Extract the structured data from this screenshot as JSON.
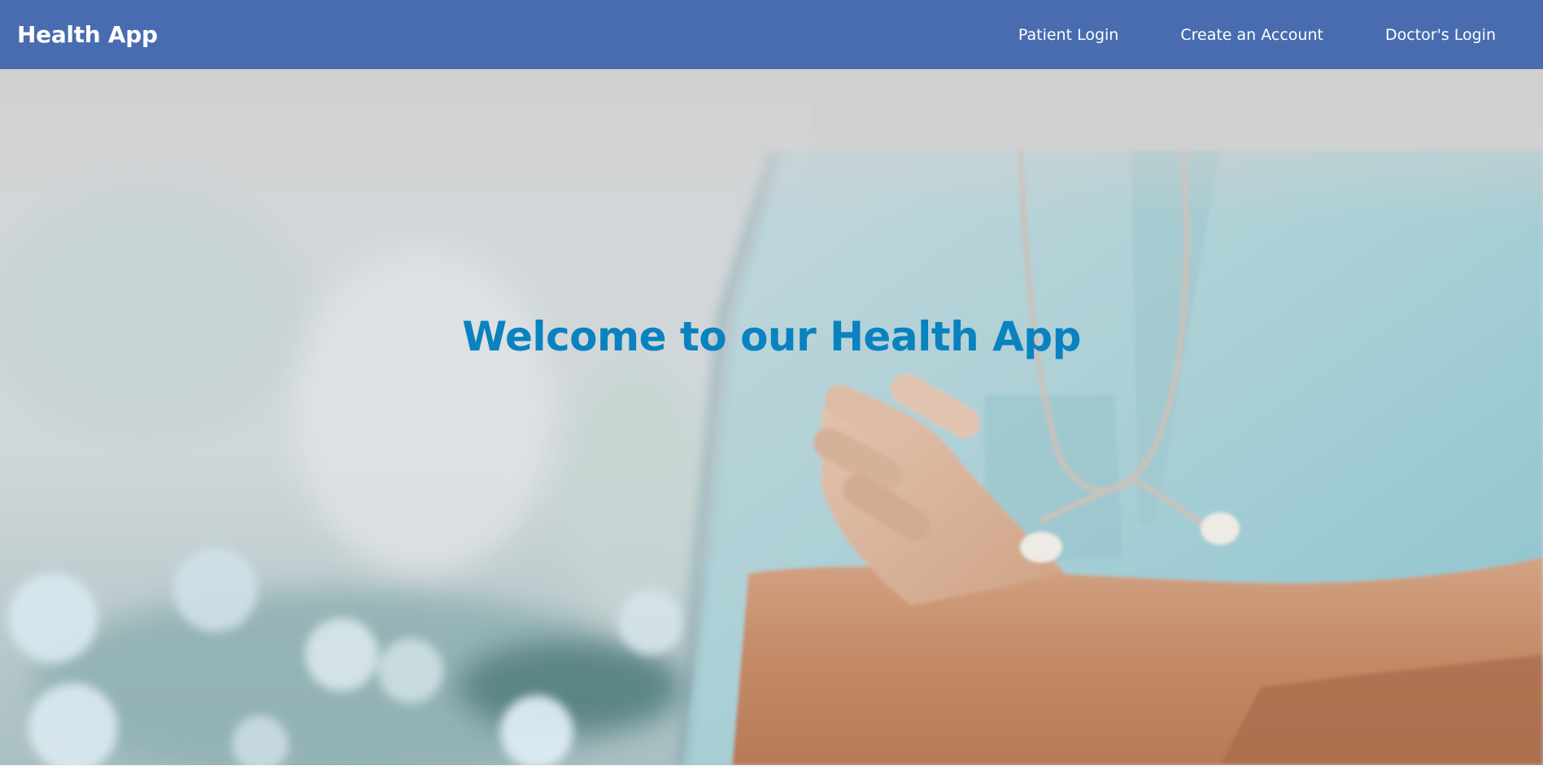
{
  "navbar": {
    "brand": "Health App",
    "links": [
      {
        "label": "Patient Login"
      },
      {
        "label": "Create an Account"
      },
      {
        "label": "Doctor's Login"
      }
    ],
    "background_color": "#486caf"
  },
  "hero": {
    "title": "Welcome to our Health App",
    "title_color": "#0a82c0",
    "background_image": "blurred-photo-of-medical-worker-in-scrubs-with-stethoscope-and-crossed-arms"
  }
}
